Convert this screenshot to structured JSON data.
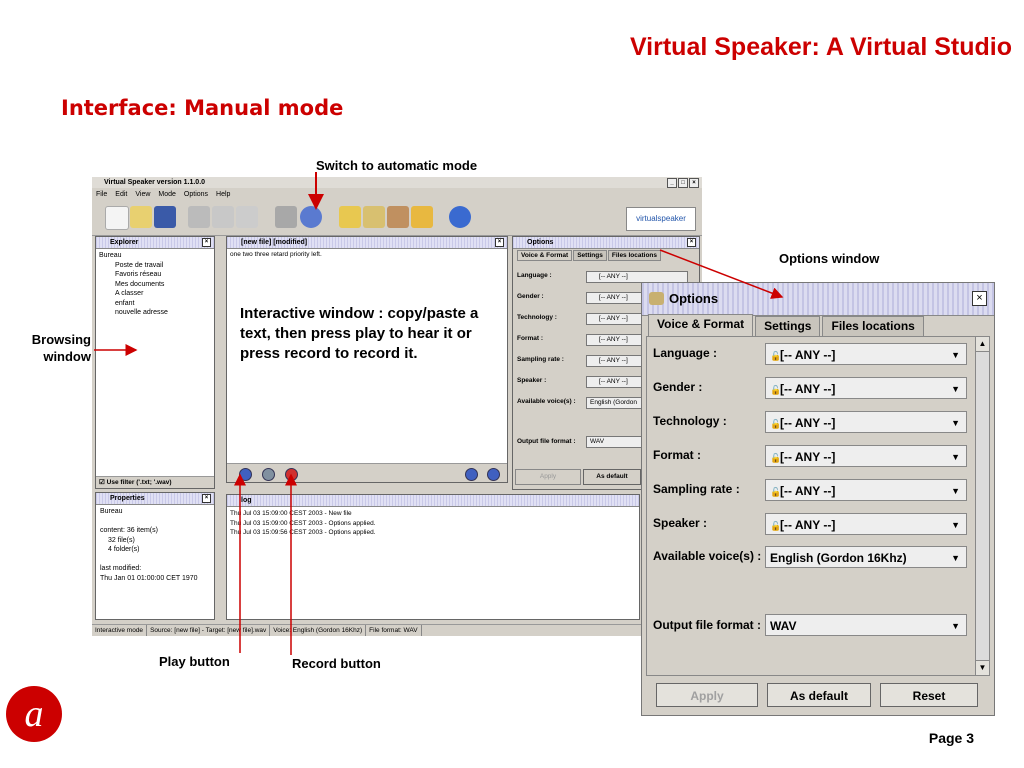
{
  "slide": {
    "title": "Virtual Speaker: A Virtual Studio",
    "subtitle": "Interface: Manual mode",
    "page": "Page 3",
    "callouts": {
      "switch": "Switch to automatic mode",
      "options": "Options window",
      "browsing_line1": "Browsing",
      "browsing_line2": "window",
      "interactive": "Interactive window : copy/paste a text, then press play to hear it or press record to record it.",
      "play": "Play button",
      "record": "Record button"
    }
  },
  "app": {
    "title": "Virtual Speaker version 1.1.0.0",
    "menu": [
      "File",
      "Edit",
      "View",
      "Mode",
      "Options",
      "Help"
    ],
    "logo_text": "virtualspeaker",
    "explorer": {
      "title": "Explorer",
      "items": [
        "Bureau",
        "Poste de travail",
        "Favoris réseau",
        "Mes documents",
        "A classer",
        "enfant",
        "nouvelle adresse"
      ],
      "filter": "Use filter ('.txt; '.wav)"
    },
    "properties": {
      "title": "Properties",
      "lines": [
        "Bureau",
        "",
        "content: 36 item(s)",
        "32 file(s)",
        "4 folder(s)",
        "",
        "last modified:",
        "Thu Jan 01 01:00:00 CET 1970"
      ]
    },
    "editor": {
      "title": "[new file] [modified]",
      "text": "one two three retard priority left."
    },
    "options_small": {
      "title": "Options",
      "tabs": [
        "Voice & Format",
        "Settings",
        "Files locations"
      ],
      "rows": [
        {
          "label": "Language :",
          "value": "[-- ANY --]"
        },
        {
          "label": "Gender :",
          "value": "[-- ANY --]"
        },
        {
          "label": "Technology :",
          "value": "[-- ANY --]"
        },
        {
          "label": "Format :",
          "value": "[-- ANY --]"
        },
        {
          "label": "Sampling rate :",
          "value": "[-- ANY --]"
        },
        {
          "label": "Speaker :",
          "value": "[-- ANY --]"
        },
        {
          "label": "Available voice(s) :",
          "value": "English (Gordon"
        }
      ],
      "output_label": "Output file format :",
      "output_value": "WAV",
      "apply": "Apply",
      "as_default": "As default"
    },
    "log": {
      "title": "log",
      "lines": [
        "Thu Jul 03 15:09:00 CEST 2003 - New file",
        "Thu Jul 03 15:09:00 CEST 2003 - Options applied.",
        "Thu Jul 03 15:09:56 CEST 2003 - Options applied."
      ]
    },
    "status": [
      "Interactive mode",
      "Source: [new file] - Target: [new file].wav",
      "Voice: English (Gordon 16Khz)",
      "File format: WAV"
    ]
  },
  "options_zoom": {
    "title": "Options",
    "tabs": [
      "Voice & Format",
      "Settings",
      "Files locations"
    ],
    "rows": [
      {
        "label": "Language :",
        "value": "[-- ANY --]"
      },
      {
        "label": "Gender :",
        "value": "[-- ANY --]"
      },
      {
        "label": "Technology :",
        "value": "[-- ANY --]"
      },
      {
        "label": "Format :",
        "value": "[-- ANY --]"
      },
      {
        "label": "Sampling rate :",
        "value": "[-- ANY --]"
      },
      {
        "label": "Speaker :",
        "value": "[-- ANY --]"
      },
      {
        "label": "Available voice(s) :",
        "value": "English (Gordon 16Khz)"
      }
    ],
    "output_label": "Output file format :",
    "output_value": "WAV",
    "buttons": {
      "apply": "Apply",
      "as_default": "As default",
      "reset": "Reset"
    }
  }
}
